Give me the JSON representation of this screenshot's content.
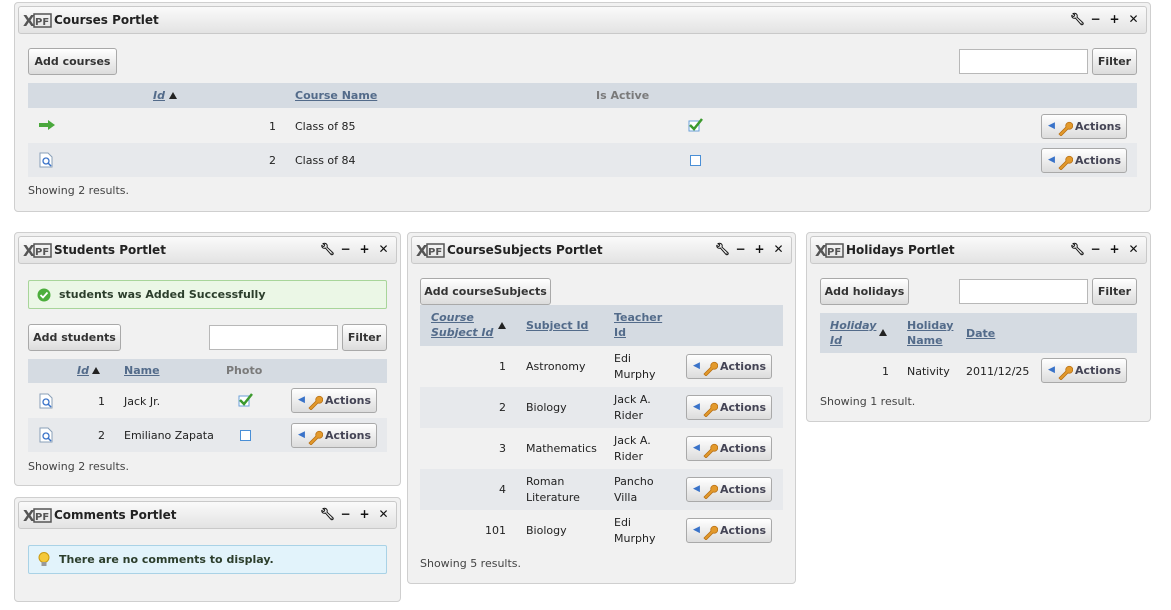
{
  "courses": {
    "title": "Courses Portlet",
    "add_label": "Add courses",
    "filter_label": "Filter",
    "filter_value": "",
    "columns": [
      "Id",
      "Course Name",
      "Is Active"
    ],
    "rows": [
      {
        "id": "1",
        "name": "Class of 85",
        "active": true,
        "actions": "Actions"
      },
      {
        "id": "2",
        "name": "Class of 84",
        "active": false,
        "actions": "Actions"
      }
    ],
    "footer": "Showing 2 results."
  },
  "students": {
    "title": "Students Portlet",
    "message": "students was Added Successfully",
    "add_label": "Add students",
    "filter_label": "Filter",
    "filter_value": "",
    "columns": [
      "Id",
      "Name",
      "Photo"
    ],
    "rows": [
      {
        "id": "1",
        "name": "Jack Jr.",
        "photo": true,
        "actions": "Actions"
      },
      {
        "id": "2",
        "name": "Emiliano Zapata",
        "photo": false,
        "actions": "Actions"
      }
    ],
    "footer": "Showing 2 results."
  },
  "comments": {
    "title": "Comments Portlet",
    "message": "There are no comments to display."
  },
  "coursesubjects": {
    "title": "CourseSubjects Portlet",
    "add_label": "Add courseSubjects",
    "columns": {
      "c1a": "Course",
      "c1b": "Subject Id",
      "c2": "Subject Id",
      "c3a": "Teacher",
      "c3b": "Id"
    },
    "rows": [
      {
        "id": "1",
        "subject": "Astronomy",
        "subject2": "",
        "teacher": "Edi",
        "teacher2": "Murphy",
        "actions": "Actions"
      },
      {
        "id": "2",
        "subject": "Biology",
        "subject2": "",
        "teacher": "Jack A.",
        "teacher2": "Rider",
        "actions": "Actions"
      },
      {
        "id": "3",
        "subject": "Mathematics",
        "subject2": "",
        "teacher": "Jack A.",
        "teacher2": "Rider",
        "actions": "Actions"
      },
      {
        "id": "4",
        "subject": "Roman",
        "subject2": "Literature",
        "teacher": "Pancho",
        "teacher2": "Villa",
        "actions": "Actions"
      },
      {
        "id": "101",
        "subject": "Biology",
        "subject2": "",
        "teacher": "Edi",
        "teacher2": "Murphy",
        "actions": "Actions"
      }
    ],
    "footer": "Showing 5 results."
  },
  "holidays": {
    "title": "Holidays Portlet",
    "add_label": "Add holidays",
    "filter_label": "Filter",
    "filter_value": "",
    "columns": {
      "c1a": "Holiday",
      "c1b": "Id",
      "c2a": "Holiday",
      "c2b": "Name",
      "c3": "Date"
    },
    "rows": [
      {
        "id": "1",
        "name": "Nativity",
        "date": "2011/12/25",
        "actions": "Actions"
      }
    ],
    "footer": "Showing 1 result."
  },
  "icons": {
    "window_tools": [
      "wrench-icon",
      "minimize-icon",
      "maximize-icon",
      "close-icon"
    ],
    "active_check": "check-icon",
    "inactive_box": "empty-checkbox-icon",
    "row_selected": "arrow-right-icon",
    "row_view": "view-document-icon",
    "actions": "wrench-icon",
    "success": "success-icon",
    "info": "lightbulb-icon"
  },
  "colors": {
    "grid_header": "#d5dbe2",
    "alt_row": "#e7e9ec",
    "success_bg": "#ebf7e6",
    "info_bg": "#e2f3fb"
  }
}
